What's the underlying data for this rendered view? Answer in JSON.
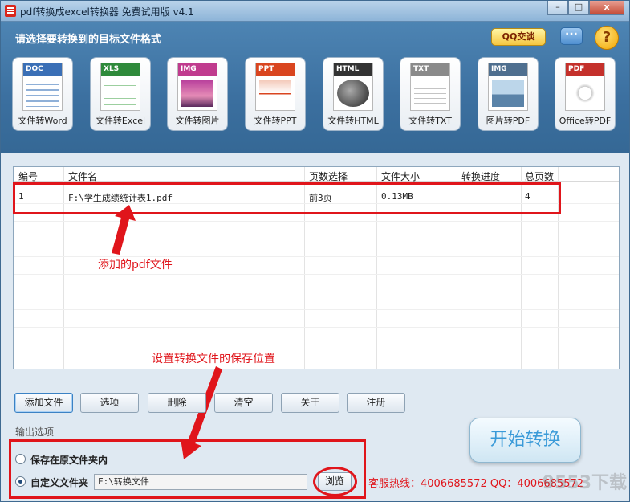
{
  "window": {
    "title": "pdf转换成excel转换器 免费试用版 v4.1",
    "controls": {
      "minimize": "–",
      "maximize": "□",
      "close": "x"
    }
  },
  "header": {
    "title": "请选择要转换到的目标文件格式",
    "qq_label": "QQ交谈",
    "chat_symbol": "···",
    "help_symbol": "?"
  },
  "formats": [
    {
      "tag": "DOC",
      "label": "文件转Word",
      "color": "#3a6fb6"
    },
    {
      "tag": "XLS",
      "label": "文件转Excel",
      "color": "#2f8a3b"
    },
    {
      "tag": "IMG",
      "label": "文件转图片",
      "color": "#c03b8e"
    },
    {
      "tag": "PPT",
      "label": "文件转PPT",
      "color": "#d9451f"
    },
    {
      "tag": "HTML",
      "label": "文件转HTML",
      "color": "#333333"
    },
    {
      "tag": "TXT",
      "label": "文件转TXT",
      "color": "#8a8a8a"
    },
    {
      "tag": "IMG",
      "label": "图片转PDF",
      "color": "#4f6f8f"
    },
    {
      "tag": "PDF",
      "label": "Office转PDF",
      "color": "#c4302b"
    }
  ],
  "table": {
    "columns": [
      "编号",
      "文件名",
      "页数选择",
      "文件大小",
      "转换进度",
      "总页数"
    ],
    "rows": [
      [
        "1",
        "F:\\学生成绩统计表1.pdf",
        "前3页",
        "0.13MB",
        "",
        "4"
      ]
    ]
  },
  "annotations": {
    "added_file": "添加的pdf文件",
    "save_location": "设置转换文件的保存位置"
  },
  "buttons": {
    "add_file": "添加文件",
    "options": "选项",
    "delete": "删除",
    "clear": "清空",
    "about": "关于",
    "register": "注册"
  },
  "output": {
    "section_label": "输出选项",
    "option_original": "保存在原文件夹内",
    "option_custom": "自定义文件夹",
    "custom_path": "F:\\转换文件",
    "browse": "浏览"
  },
  "start_button": "开始转换",
  "hotline": "客服热线：4006685572 QQ：4006685572",
  "watermark": "9553下载",
  "colors": {
    "accent_red": "#e0151b",
    "header_blue": "#3b6f9f"
  }
}
